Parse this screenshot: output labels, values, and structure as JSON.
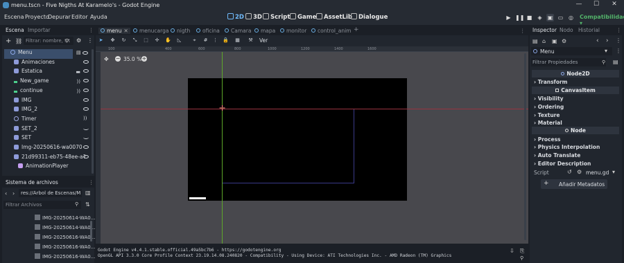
{
  "window": {
    "title": "menu.tscn - Five Nigths At Karamelo's - Godot Engine",
    "minimize": "—",
    "maximize": "☐",
    "close": "✕"
  },
  "menubar": {
    "items": [
      "Escena",
      "Proyecto",
      "Depurar",
      "Editor",
      "Ayuda"
    ],
    "workspaces": [
      "2D",
      "3D",
      "Script",
      "Game",
      "AssetLib",
      "Dialogue"
    ],
    "active_workspace": "2D",
    "renderer": "Compatibilidad",
    "renderer_dropdown": "▾"
  },
  "scene_dock": {
    "tabs": [
      "Escena",
      "Importar"
    ],
    "active_tab": "Escena",
    "filter_placeholder": "Filtrar: nombre, t:t",
    "nodes": [
      {
        "name": "Menu",
        "icon": "circle-node-icon",
        "root": true
      },
      {
        "name": "Animaciones",
        "icon": "node2d-icon"
      },
      {
        "name": "Estatica",
        "icon": "node2d-icon"
      },
      {
        "name": "New_game",
        "icon": "button-icon"
      },
      {
        "name": "continue",
        "icon": "button-icon"
      },
      {
        "name": "IMG",
        "icon": "sprite-icon"
      },
      {
        "name": "IMG_2",
        "icon": "sprite-icon"
      },
      {
        "name": "Timer",
        "icon": "timer-icon"
      },
      {
        "name": "SET_2",
        "icon": "sprite-icon"
      },
      {
        "name": "SET",
        "icon": "sprite-icon"
      },
      {
        "name": "Img-20250616-wa0070",
        "icon": "sprite-icon"
      },
      {
        "name": "21d99311-eb75-48ee-a78d",
        "icon": "sprite-icon"
      },
      {
        "name": "AnimationPlayer",
        "icon": "animation-player-icon"
      }
    ]
  },
  "filesystem": {
    "title": "Sistema de archivos",
    "path": "res://Árbol de Escenas/Men",
    "filter_placeholder": "Filtrar Archivos",
    "files": [
      "IMG-20250614-WA0...",
      "IMG-20250614-WA0...",
      "IMG-20250616-WA0...",
      "IMG-20250616-WA0...",
      "IMG-20250616-WA0..."
    ]
  },
  "editor_tabs": [
    "menu",
    "menucarga",
    "nigth",
    "oficina",
    "Camara",
    "mapa",
    "monitor",
    "control_anim"
  ],
  "active_editor_tab": "menu",
  "toolbar": {
    "view_label": "Ver"
  },
  "viewport": {
    "zoom": "35.0 %",
    "ruler_marks": [
      "100",
      "400",
      "600",
      "800",
      "1000",
      "1200",
      "1400",
      "1600"
    ]
  },
  "output": {
    "line1": "Godot Engine v4.4.1.stable.official.49a5bc7b6 - https://godotengine.org",
    "line2": "OpenGL API 3.3.0 Core Profile Context 23.19.14.08.240820 - Compatibility - Using Device: ATI Technologies Inc. - AMD Radeon (TM) Graphics"
  },
  "inspector": {
    "tabs": [
      "Inspector",
      "Nodo",
      "Historial"
    ],
    "active_tab": "Inspector",
    "node": "Menu",
    "filter_placeholder": "Filtrar Propiedades",
    "sections": [
      {
        "header": "Node2D",
        "rows": [
          "Transform"
        ]
      },
      {
        "header": "CanvasItem",
        "rows": [
          "Visibility",
          "Ordering",
          "Texture",
          "Material"
        ]
      },
      {
        "header": "Node",
        "rows": [
          "Process",
          "Physics Interpolation",
          "Auto Translate",
          "Editor Description"
        ]
      }
    ],
    "script_label": "Script",
    "script_value": "menu.gd",
    "add_metadata": "Añadir Metadatos"
  },
  "colors": {
    "accent": "#70bafa",
    "renderer": "#53b46a",
    "bg": "#1b1f26",
    "panel": "#21262e",
    "viewport": "#4a4a4f"
  }
}
